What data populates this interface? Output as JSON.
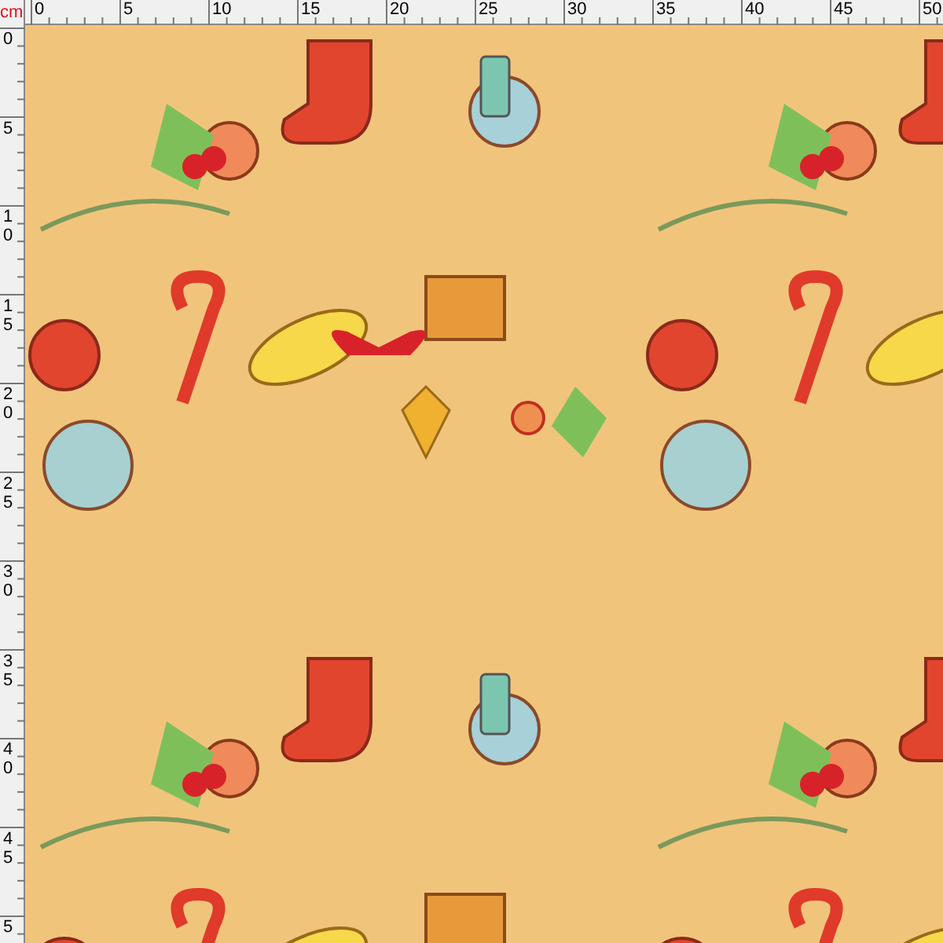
{
  "ruler_unit": "cm",
  "top_ruler": {
    "labels": [
      "0",
      "5",
      "10",
      "15",
      "20",
      "25",
      "30",
      "35",
      "40",
      "45",
      "50"
    ]
  },
  "left_ruler": {
    "labels": [
      "0",
      "5",
      "10",
      "15",
      "20",
      "25",
      "30",
      "35",
      "40",
      "45",
      "5"
    ]
  }
}
